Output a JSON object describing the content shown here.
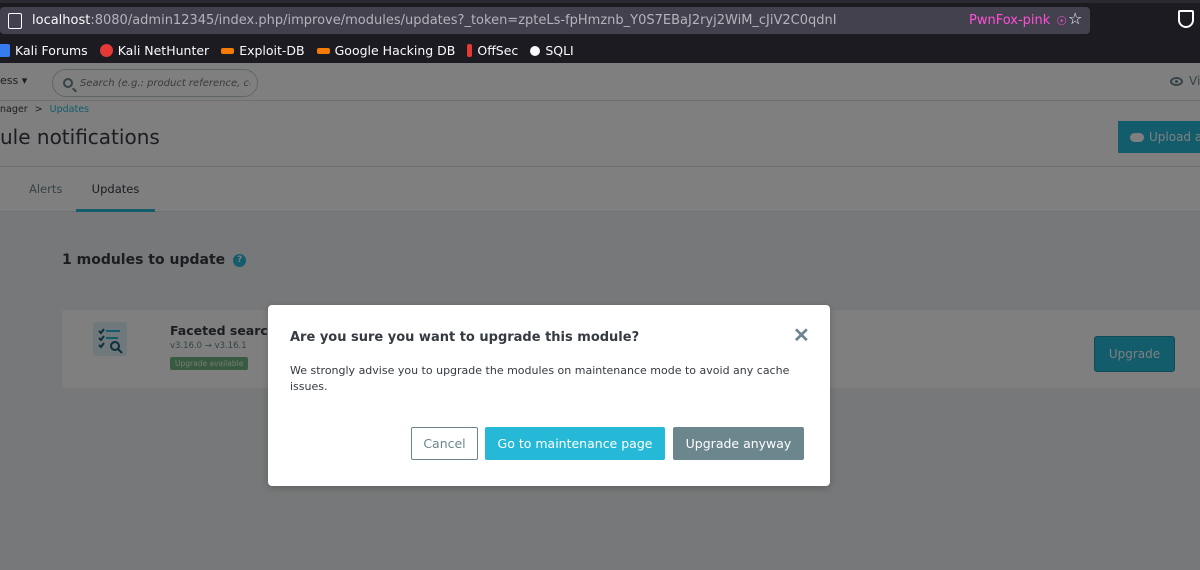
{
  "browser": {
    "url_host": "localhost",
    "url_rest": ":8080/admin12345/index.php/improve/modules/updates?_token=zpteLs-fpHmznb_Y0S7EBaJ2ryj2WiM_cJiV2C0qdnI",
    "container_label": "PwnFox-pink",
    "bookmarks": [
      {
        "label": "Kali Forums",
        "icon": "kali-forums-icon",
        "color": "#367bf0"
      },
      {
        "label": "Kali NetHunter",
        "icon": "kali-nethunter-icon",
        "color": "#e53935"
      },
      {
        "label": "Exploit-DB",
        "icon": "exploit-db-icon",
        "color": "#f57c00"
      },
      {
        "label": "Google Hacking DB",
        "icon": "ghdb-icon",
        "color": "#f57c00"
      },
      {
        "label": "OffSec",
        "icon": "offsec-icon",
        "color": "#e53935"
      },
      {
        "label": "SQLI",
        "icon": "sqli-icon",
        "color": "#fbfbfe"
      }
    ]
  },
  "topbar": {
    "quick_access": "ess ▾",
    "search_placeholder": "Search (e.g.: product reference, custon",
    "view_label": "Vi"
  },
  "header": {
    "breadcrumb_parent": "nager",
    "breadcrumb_sep": ">",
    "breadcrumb_current": "Updates",
    "title": "ule notifications",
    "upload_label": "Upload a"
  },
  "tabs": [
    {
      "label": "Alerts",
      "active": false
    },
    {
      "label": "Updates",
      "active": true
    }
  ],
  "content": {
    "section_title": "1 modules to update",
    "help_glyph": "?",
    "module": {
      "name": "Faceted search",
      "version": "v3.16.0 → v3.16.1",
      "badge": "Upgrade available",
      "upgrade_label": "Upgrade"
    }
  },
  "modal": {
    "title": "Are you sure you want to upgrade this module?",
    "close_glyph": "✕",
    "body": "We strongly advise you to upgrade the modules on maintenance mode to avoid any cache issues.",
    "cancel_label": "Cancel",
    "maintenance_label": "Go to maintenance page",
    "upgrade_anyway_label": "Upgrade anyway"
  },
  "colors": {
    "primary": "#25b9d7",
    "secondary": "#6c868e",
    "badge_green": "#70b580",
    "container_pink": "#ff4fd8"
  }
}
